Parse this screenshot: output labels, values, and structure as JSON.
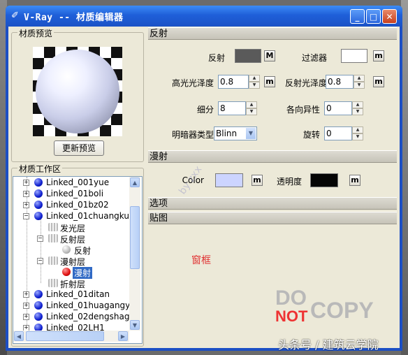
{
  "window": {
    "title": "V-Ray -- 材质编辑器",
    "icon": "vray-icon",
    "buttons": {
      "minimize": "_",
      "maximize": "□",
      "close": "✕"
    }
  },
  "preview": {
    "group_title": "材质预览",
    "update_button": "更新预览"
  },
  "workspace": {
    "group_title": "材质工作区",
    "tree": [
      {
        "label": "Linked_001yue",
        "icon": "blue-ball",
        "expander": "+"
      },
      {
        "label": "Linked_01boli",
        "icon": "blue-ball",
        "expander": "+"
      },
      {
        "label": "Linked_01bz02",
        "icon": "blue-ball",
        "expander": "+"
      },
      {
        "label": "Linked_01chuangku",
        "icon": "blue-ball",
        "expander": "−"
      },
      {
        "label": "发光层",
        "icon": "layer"
      },
      {
        "label": "反射层",
        "icon": "layer",
        "expander": "−"
      },
      {
        "label": "反射",
        "icon": "gray-ball"
      },
      {
        "label": "漫射层",
        "icon": "layer",
        "expander": "−"
      },
      {
        "label": "漫射",
        "icon": "red-ball"
      },
      {
        "label": "折射层",
        "icon": "layer"
      },
      {
        "label": "Linked_01ditan",
        "icon": "blue-ball",
        "expander": "+"
      },
      {
        "label": "Linked_01huagangy",
        "icon": "blue-ball",
        "expander": "+"
      },
      {
        "label": "Linked_02dengshag",
        "icon": "blue-ball",
        "expander": "+"
      },
      {
        "label": "Linked_02LH1",
        "icon": "blue-ball",
        "expander": "+"
      }
    ]
  },
  "reflection": {
    "section_title": "反射",
    "reflect_label": "反射",
    "reflect_color": "#5a5a5a",
    "reflect_map_button": "M",
    "filter_label": "过滤器",
    "filter_color": "#ffffff",
    "filter_map_button": "m",
    "hilight_gloss_label": "高光光泽度",
    "hilight_gloss_value": "0.8",
    "hilight_gloss_map_button": "m",
    "refl_gloss_label": "反射光泽度",
    "refl_gloss_value": "0.8",
    "refl_gloss_map_button": "m",
    "subdivs_label": "细分",
    "subdivs_value": "8",
    "anisotropy_label": "各向异性",
    "anisotropy_value": "0",
    "shader_label": "明暗器类型",
    "shader_value": "Blinn",
    "rotation_label": "旋转",
    "rotation_value": "0"
  },
  "diffuse": {
    "section_title": "漫射",
    "color_label": "Color",
    "color_value": "#ccd4ff",
    "color_map_button": "m",
    "transparency_label": "透明度",
    "transparency_color": "#050505",
    "transparency_map_button": "m"
  },
  "options": {
    "section_title": "选项"
  },
  "maps": {
    "section_title": "贴图",
    "annotation": "窗框"
  },
  "watermarks": {
    "diagonal": "by zxx",
    "logo_do": "DO",
    "logo_not": "NOT",
    "logo_copy": "COPY",
    "caption": "头条号 / 建筑云学院"
  },
  "colors": {
    "titlebar": "#1f5fd9",
    "panel": "#ece9d8",
    "annotation_red": "#e03030"
  }
}
